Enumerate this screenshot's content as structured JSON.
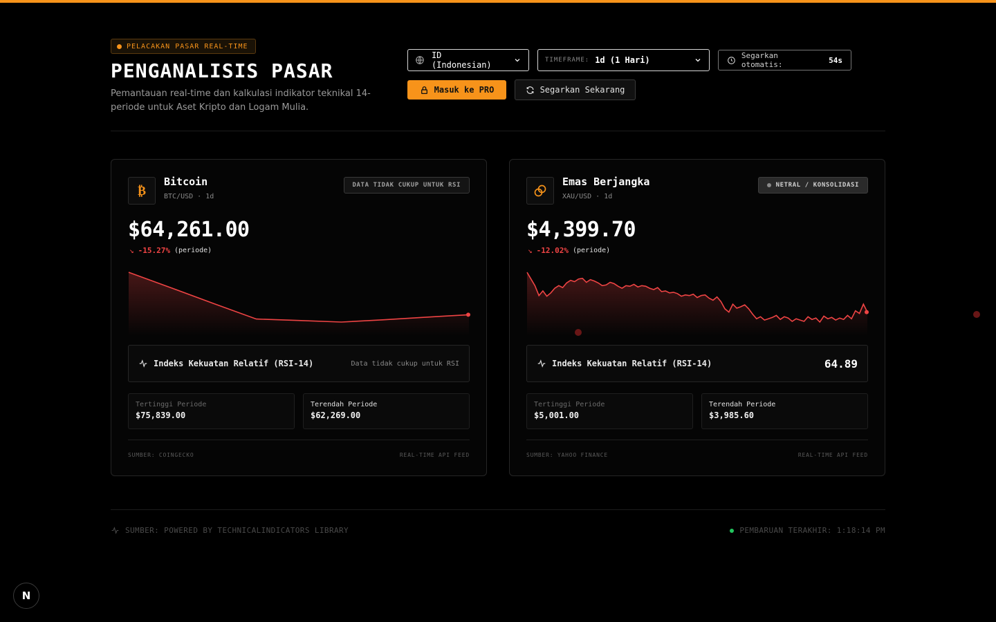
{
  "header": {
    "badge": "PELACAKAN PASAR REAL-TIME",
    "title": "PENGANALISIS PASAR",
    "subtitle": "Pemantauan real-time dan kalkulasi indikator teknikal 14-periode untuk Aset Kripto dan Logam Mulia."
  },
  "controls": {
    "language": "ID (Indonesian)",
    "timeframe_label": "TIMEFRAME:",
    "timeframe_value": "1d (1 Hari)",
    "auto_refresh_label": "Segarkan otomatis:",
    "auto_refresh_value": "54s",
    "pro_button": "Masuk ke PRO",
    "refresh_button": "Segarkan Sekarang"
  },
  "colors": {
    "accent": "#f7931a",
    "negative": "#ef4444",
    "live": "#22c55e"
  },
  "cards": [
    {
      "icon": "bitcoin-icon",
      "name": "Bitcoin",
      "pair": "BTC/USD · 1d",
      "status": "DATA TIDAK CUKUP UNTUK RSI",
      "price": "$64,261.00",
      "change": "-15.27%",
      "change_suffix": "(periode)",
      "rsi_label": "Indeks Kekuatan Relatif (RSI-14)",
      "rsi_note": "Data tidak cukup untuk RSI",
      "high_label": "Tertinggi Periode",
      "high_value": "$75,839.00",
      "low_label": "Terendah Periode",
      "low_value": "$62,269.00",
      "source": "SUMBER: COINGECKO",
      "feed": "REAL-TIME API FEED",
      "series": [
        75839,
        71600,
        67300,
        63100,
        62700,
        62269,
        62900,
        63600,
        64261
      ]
    },
    {
      "icon": "gold-coins-icon",
      "name": "Emas Berjangka",
      "pair": "XAU/USD · 1d",
      "status": "NETRAL / KONSOLIDASI",
      "price": "$4,399.70",
      "change": "-12.02%",
      "change_suffix": "(periode)",
      "rsi_label": "Indeks Kekuatan Relatif (RSI-14)",
      "rsi_value": "64.89",
      "high_label": "Tertinggi Periode",
      "high_value": "$5,001.00",
      "low_label": "Terendah Periode",
      "low_value": "$3,985.60",
      "source": "SUMBER: YAHOO FINANCE",
      "feed": "REAL-TIME API FEED",
      "series": [
        5001,
        4900,
        4800,
        4650,
        4720,
        4640,
        4690,
        4760,
        4800,
        4770,
        4840,
        4880,
        4860,
        4900,
        4910,
        4850,
        4890,
        4870,
        4840,
        4800,
        4810,
        4850,
        4830,
        4790,
        4760,
        4800,
        4790,
        4820,
        4780,
        4800,
        4790,
        4760,
        4740,
        4770,
        4710,
        4720,
        4690,
        4700,
        4680,
        4640,
        4660,
        4650,
        4670,
        4620,
        4650,
        4660,
        4610,
        4580,
        4630,
        4560,
        4450,
        4400,
        4520,
        4460,
        4480,
        4510,
        4450,
        4370,
        4300,
        4330,
        4280,
        4300,
        4320,
        4350,
        4290,
        4330,
        4310,
        4260,
        4300,
        4280,
        4260,
        4330,
        4290,
        4310,
        4250,
        4340,
        4300,
        4320,
        4280,
        4310,
        4290,
        4350,
        4300,
        4420,
        4380,
        4520,
        4399.7
      ]
    }
  ],
  "footer": {
    "source": "SUMBER: POWERED BY TECHNICALINDICATORS LIBRARY",
    "updated": "PEMBARUAN TERAKHIR: 1:18:14 PM"
  },
  "dev_badge": "N"
}
